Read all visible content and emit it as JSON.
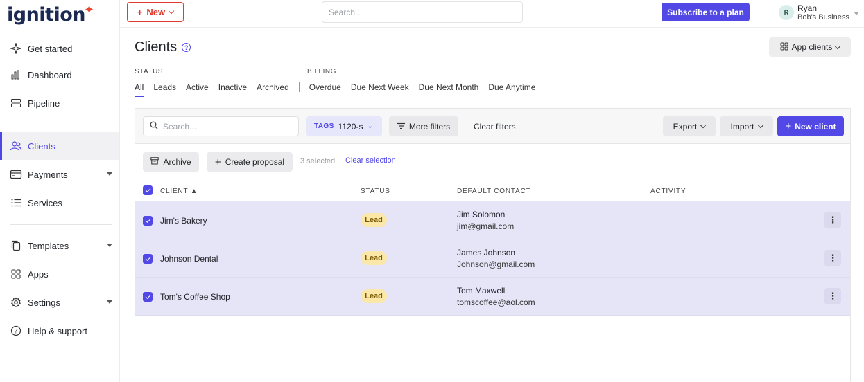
{
  "app": {
    "logo": "ignition"
  },
  "sidebar": {
    "items": [
      {
        "label": "Get started",
        "icon": "sparkle-icon"
      },
      {
        "label": "Dashboard",
        "icon": "bar-chart-icon"
      },
      {
        "label": "Pipeline",
        "icon": "pipeline-icon"
      },
      {
        "label": "Clients",
        "icon": "users-icon",
        "active": true
      },
      {
        "label": "Payments",
        "icon": "card-icon",
        "expandable": true
      },
      {
        "label": "Services",
        "icon": "list-icon"
      },
      {
        "label": "Templates",
        "icon": "copy-icon",
        "expandable": true
      },
      {
        "label": "Apps",
        "icon": "grid-icon"
      },
      {
        "label": "Settings",
        "icon": "gear-icon",
        "expandable": true
      },
      {
        "label": "Help & support",
        "icon": "help-icon"
      }
    ]
  },
  "topbar": {
    "new_label": "New",
    "search_placeholder": "Search...",
    "subscribe_label": "Subscribe to a plan",
    "user": {
      "initial": "R",
      "name": "Ryan",
      "business": "Bob's Business"
    }
  },
  "page": {
    "title": "Clients",
    "app_clients_label": "App clients",
    "status_heading": "STATUS",
    "billing_heading": "BILLING",
    "status_filters": [
      "All",
      "Leads",
      "Active",
      "Inactive",
      "Archived"
    ],
    "billing_filters": [
      "Overdue",
      "Due Next Week",
      "Due Next Month",
      "Due Anytime"
    ],
    "selected_filter": "All"
  },
  "toolbar": {
    "search_placeholder": "Search...",
    "tags_label": "TAGS",
    "tags_value": "1120-s",
    "more_filters": "More filters",
    "clear_filters": "Clear filters",
    "export": "Export",
    "import": "Import",
    "new_client": "New client"
  },
  "bulk": {
    "archive": "Archive",
    "create_proposal": "Create proposal",
    "selected_text": "3 selected",
    "clear_selection": "Clear selection"
  },
  "table": {
    "headers": {
      "client": "CLIENT",
      "status": "STATUS",
      "contact": "DEFAULT CONTACT",
      "activity": "ACTIVITY"
    },
    "rows": [
      {
        "client": "Jim's Bakery",
        "status": "Lead",
        "contact_name": "Jim Solomon",
        "contact_email": "jim@gmail.com"
      },
      {
        "client": "Johnson Dental",
        "status": "Lead",
        "contact_name": "James Johnson",
        "contact_email": "Johnson@gmail.com"
      },
      {
        "client": "Tom's Coffee Shop",
        "status": "Lead",
        "contact_name": "Tom Maxwell",
        "contact_email": "tomscoffee@aol.com"
      }
    ]
  },
  "colors": {
    "accent": "#5148e6",
    "brand_red": "#e03b2e",
    "lead_badge": "#fbe7a8",
    "row_selected": "#e6e5f8"
  }
}
